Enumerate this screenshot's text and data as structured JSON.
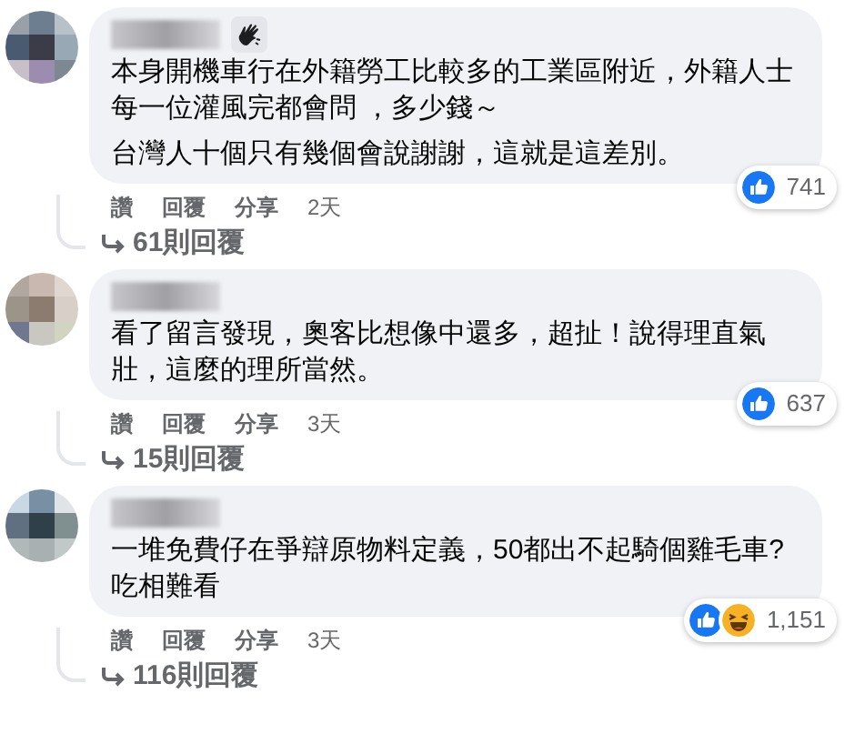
{
  "comments": [
    {
      "badge": true,
      "paragraphs": [
        "本身開機車行在外籍勞工比較多的工業區附近，外籍人士每一位灌風完都會問 ，多少錢～",
        "台灣人十個只有幾個會說謝謝，這就是這差別。"
      ],
      "reactions": [
        {
          "kind": "like"
        }
      ],
      "reaction_count": "741",
      "actions": [
        "讚",
        "回覆",
        "分享"
      ],
      "time": "2天",
      "replies": "61則回覆"
    },
    {
      "badge": false,
      "paragraphs": [
        "看了留言發現，奧客比想像中還多，超扯！說得理直氣壯，這麼的理所當然。"
      ],
      "reactions": [
        {
          "kind": "like"
        }
      ],
      "reaction_count": "637",
      "actions": [
        "讚",
        "回覆",
        "分享"
      ],
      "time": "3天",
      "replies": "15則回覆"
    },
    {
      "badge": false,
      "paragraphs": [
        "一堆免費仔在爭辯原物料定義，50都出不起騎個雞毛車?吃相難看"
      ],
      "reactions": [
        {
          "kind": "like"
        },
        {
          "kind": "haha"
        }
      ],
      "reaction_count": "1,151",
      "actions": [
        "讚",
        "回覆",
        "分享"
      ],
      "time": "3天",
      "replies": "116則回覆"
    }
  ]
}
